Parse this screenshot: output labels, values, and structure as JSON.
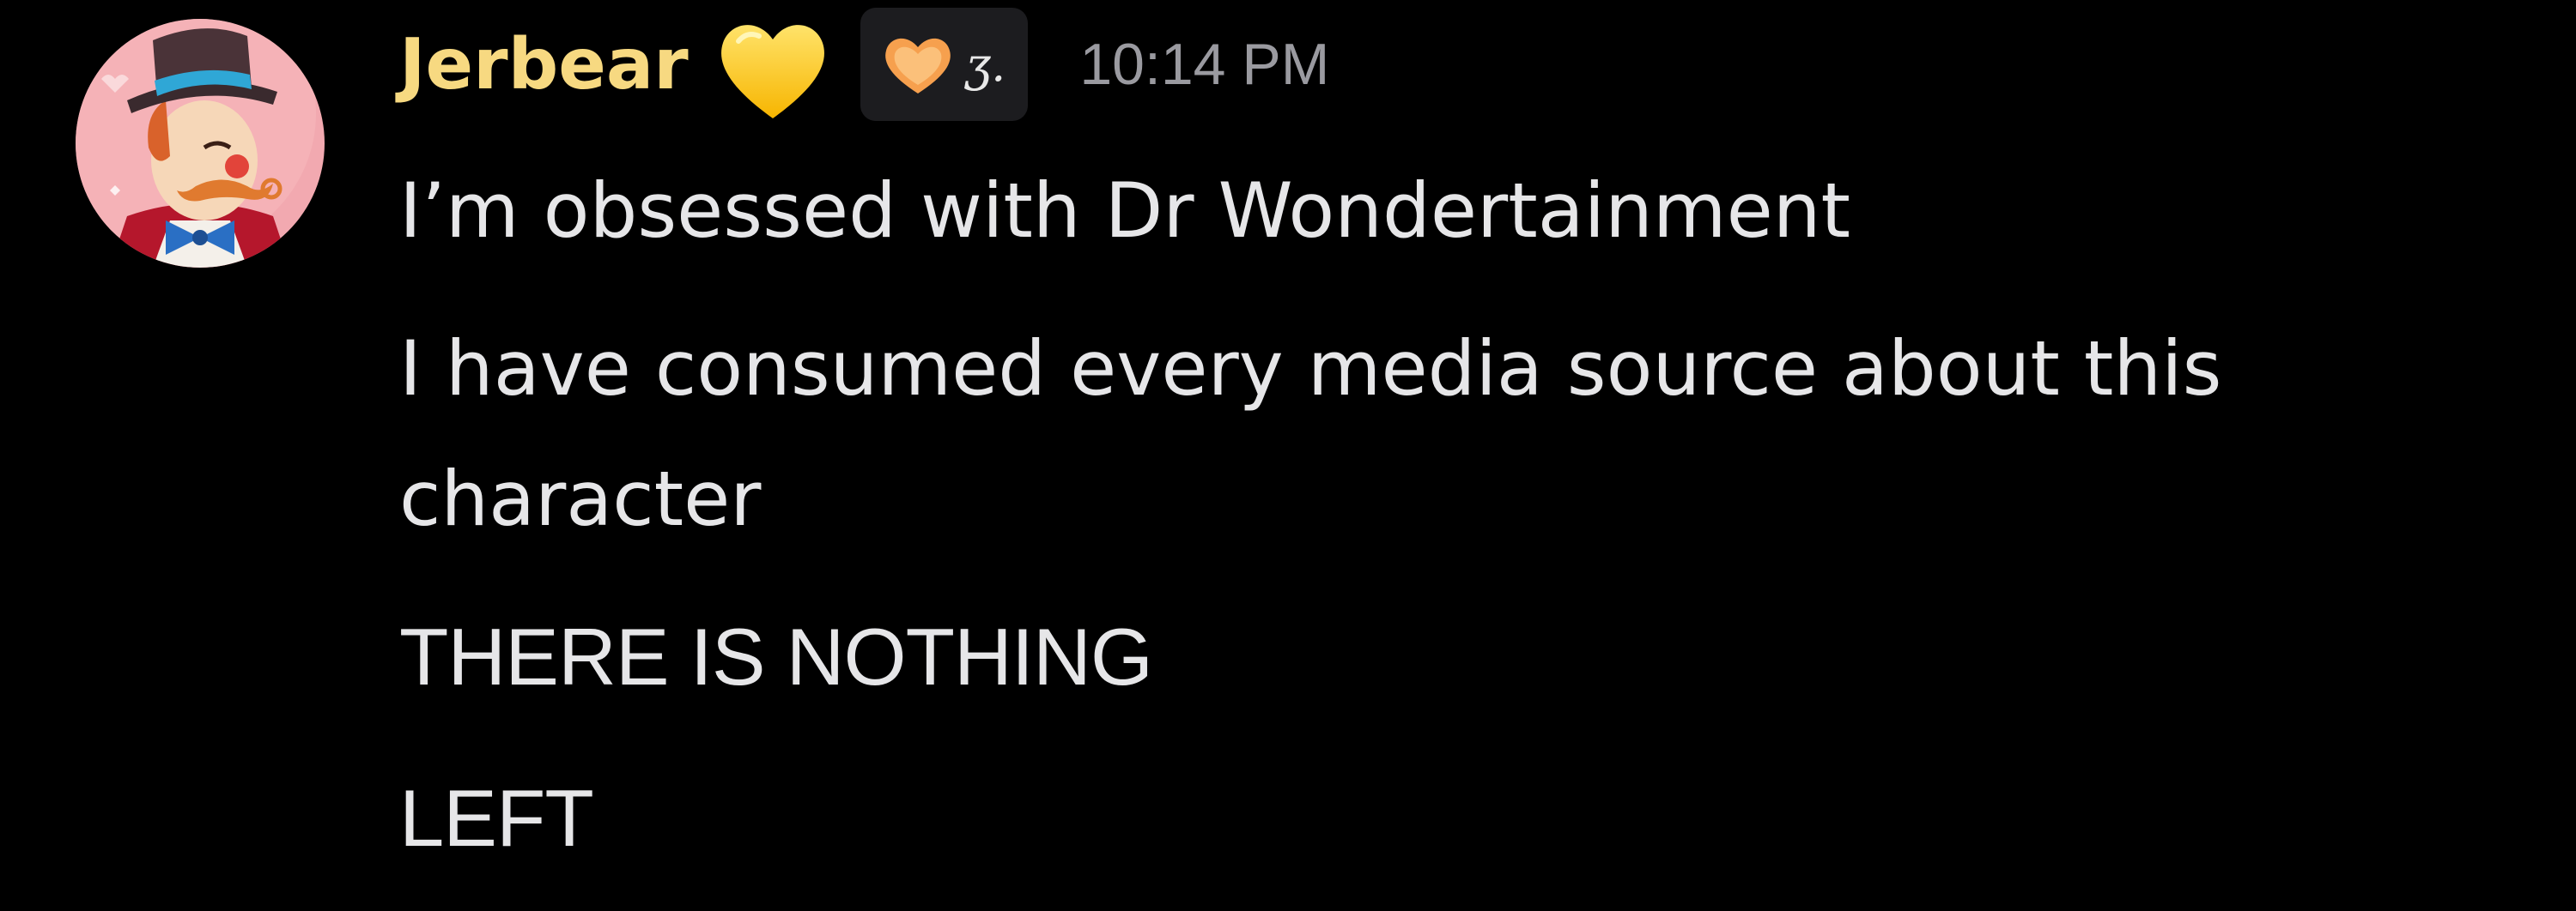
{
  "message": {
    "author": {
      "name": "Jerbear",
      "name_color": "#f7d981",
      "avatar": "clown-character-avatar",
      "badge_icon": "yellow-heart-icon"
    },
    "tag": {
      "icon": "orange-heart-icon",
      "text": "ʒ."
    },
    "timestamp": "10:14 PM",
    "lines": [
      "I’m obsessed with Dr Wondertainment",
      "I have consumed every media source about this character",
      "THERE IS NOTHING",
      "LEFT"
    ]
  },
  "colors": {
    "background": "#000000",
    "text": "#e6e6e8",
    "timestamp": "#9a9aa0",
    "tag_background": "#1c1c1f"
  }
}
